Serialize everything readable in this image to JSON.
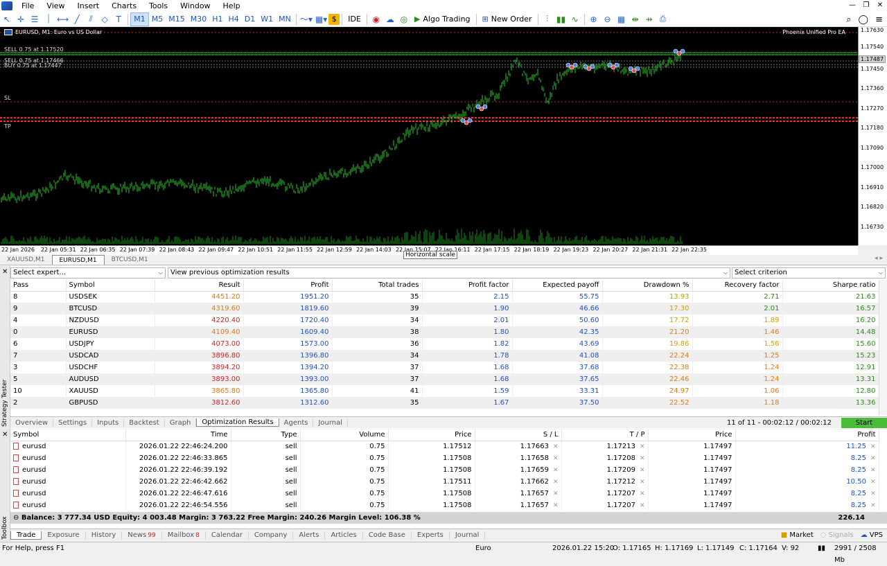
{
  "menu": [
    "File",
    "View",
    "Insert",
    "Charts",
    "Tools",
    "Window",
    "Help"
  ],
  "toolbar": {
    "timeframes": [
      "M1",
      "M5",
      "M15",
      "M30",
      "H1",
      "H4",
      "D1",
      "W1",
      "MN"
    ],
    "active_tf": "M1",
    "ide": "IDE",
    "algo_trading": "Algo Trading",
    "new_order": "New Order"
  },
  "chart": {
    "title": "EURUSD, M1:  Euro vs US Dollar",
    "ea_name": "Phoenix Unified Pro EA",
    "sell_line1": "SELL 0.75 at 1.17520",
    "sell_line2": "SELL 0.75 at 1.17466",
    "buy_line": "BUY 0.75 at 1.17447",
    "sl_label": "SL",
    "tp_label": "TP",
    "price_labels": [
      "1.17630",
      "1.17540",
      "1.17487",
      "1.17450",
      "1.17360",
      "1.17270",
      "1.17180",
      "1.17090",
      "1.17000",
      "1.16910",
      "1.16820",
      "1.16730"
    ],
    "current_price": "1.17487",
    "time_labels": [
      "22 Jan 2026",
      "22 Jan 05:31",
      "22 Jan 06:35",
      "22 Jan 07:39",
      "22 Jan 08:43",
      "22 Jan 09:47",
      "22 Jan 10:51",
      "22 Jan 11:55",
      "22 Jan 12:59",
      "22 Jan 14:03",
      "22 Jan 15:07",
      "22 Jan 16:11",
      "22 Jan 17:15",
      "22 Jan 18:19",
      "22 Jan 19:23",
      "22 Jan 20:27",
      "22 Jan 21:31",
      "22 Jan 22:35"
    ],
    "tooltip": "Horizontal scale",
    "tabs": [
      "XAUUSD,M1",
      "EURUSD,M1",
      "BTCUSD,M1"
    ],
    "active_tab": "EURUSD,M1"
  },
  "tester": {
    "select_expert": "Select expert...",
    "view_prev": "View previous optimization results",
    "select_criterion": "Select criterion",
    "columns": [
      "Pass",
      "Symbol",
      "Result",
      "Profit",
      "Total trades",
      "Profit factor",
      "Expected payoff",
      "Drawdown %",
      "Recovery factor",
      "Sharpe ratio"
    ],
    "rows": [
      [
        "8",
        "USDSEK",
        "4451.20",
        "1951.20",
        "35",
        "2.15",
        "55.75",
        "13.93",
        "2.71",
        "21.63"
      ],
      [
        "9",
        "BTCUSD",
        "4319.60",
        "1819.60",
        "39",
        "1.90",
        "46.66",
        "17.30",
        "2.01",
        "16.57"
      ],
      [
        "4",
        "NZDUSD",
        "4220.40",
        "1720.40",
        "34",
        "2.01",
        "50.60",
        "17.72",
        "1.89",
        "16.20"
      ],
      [
        "0",
        "EURUSD",
        "4109.40",
        "1609.40",
        "38",
        "1.80",
        "42.35",
        "21.20",
        "1.46",
        "14.48"
      ],
      [
        "6",
        "USDJPY",
        "4073.00",
        "1573.00",
        "36",
        "1.82",
        "43.69",
        "19.86",
        "1.56",
        "15.60"
      ],
      [
        "7",
        "USDCAD",
        "3896.80",
        "1396.80",
        "34",
        "1.78",
        "41.08",
        "22.24",
        "1.25",
        "15.23"
      ],
      [
        "3",
        "USDCHF",
        "3894.20",
        "1394.20",
        "37",
        "1.68",
        "37.68",
        "22.38",
        "1.24",
        "12.91"
      ],
      [
        "5",
        "AUDUSD",
        "3893.00",
        "1393.00",
        "37",
        "1.68",
        "37.65",
        "22.46",
        "1.24",
        "13.31"
      ],
      [
        "10",
        "XAUUSD",
        "3865.80",
        "1365.80",
        "41",
        "1.59",
        "33.31",
        "24.97",
        "1.06",
        "12.80"
      ],
      [
        "2",
        "GBPUSD",
        "3812.60",
        "1312.60",
        "35",
        "1.67",
        "37.50",
        "22.52",
        "1.18",
        "13.36"
      ]
    ],
    "tabs": [
      "Overview",
      "Settings",
      "Inputs",
      "Backtest",
      "Graph",
      "Optimization Results",
      "Agents",
      "Journal"
    ],
    "active_tab": "Optimization Results",
    "progress": "11 of 11  -  00:02:12 / 00:02:12",
    "start": "Start",
    "side_label": "Strategy Tester"
  },
  "trade": {
    "columns": [
      "Symbol",
      "Time",
      "Type",
      "Volume",
      "Price",
      "S / L",
      "T / P",
      "Price",
      "Profit"
    ],
    "rows": [
      [
        "eurusd",
        "2026.01.22 22:46:24.200",
        "sell",
        "0.75",
        "1.17512",
        "1.17663",
        "1.17213",
        "1.17497",
        "11.25"
      ],
      [
        "eurusd",
        "2026.01.22 22:46:33.865",
        "sell",
        "0.75",
        "1.17508",
        "1.17658",
        "1.17208",
        "1.17497",
        "8.25"
      ],
      [
        "eurusd",
        "2026.01.22 22:46:39.192",
        "sell",
        "0.75",
        "1.17508",
        "1.17659",
        "1.17209",
        "1.17497",
        "8.25"
      ],
      [
        "eurusd",
        "2026.01.22 22:46:42.662",
        "sell",
        "0.75",
        "1.17511",
        "1.17662",
        "1.17212",
        "1.17497",
        "10.50"
      ],
      [
        "eurusd",
        "2026.01.22 22:46:47.616",
        "sell",
        "0.75",
        "1.17508",
        "1.17657",
        "1.17207",
        "1.17497",
        "8.25"
      ],
      [
        "eurusd",
        "2026.01.22 22:46:54.556",
        "sell",
        "0.75",
        "1.17508",
        "1.17657",
        "1.17207",
        "1.17497",
        "8.25"
      ]
    ],
    "balance_line": "Balance: 3 777.34 USD  Equity: 4 003.48  Margin: 3 763.22  Free Margin: 240.26  Margin Level: 106.38 %",
    "total_profit": "226.14",
    "side_label": "Toolbox"
  },
  "toolbox_tabs": [
    {
      "label": "Trade",
      "badge": ""
    },
    {
      "label": "Exposure",
      "badge": ""
    },
    {
      "label": "History",
      "badge": ""
    },
    {
      "label": "News",
      "badge": "99"
    },
    {
      "label": "Mailbox",
      "badge": "8"
    },
    {
      "label": "Calendar",
      "badge": ""
    },
    {
      "label": "Company",
      "badge": ""
    },
    {
      "label": "Alerts",
      "badge": ""
    },
    {
      "label": "Articles",
      "badge": ""
    },
    {
      "label": "Code Base",
      "badge": ""
    },
    {
      "label": "Experts",
      "badge": ""
    },
    {
      "label": "Journal",
      "badge": ""
    }
  ],
  "toolbox_right": {
    "market": "Market",
    "signals": "Signals",
    "vps": "VPS"
  },
  "status": {
    "help": "For Help, press F1",
    "profile": "Euro",
    "datetime": "2026.01.22 15:20",
    "open": "O: 1.17165",
    "high": "H: 1.17169",
    "low": "L: 1.17149",
    "close": "C: 1.17164",
    "volume": "V: 92",
    "memory": "2991 / 2508 Mb"
  },
  "colors": {
    "candle": "#2ecc2e",
    "sl_line": "#ff2a2a",
    "start": "#4bbd3a",
    "link": "#1e50c8"
  }
}
